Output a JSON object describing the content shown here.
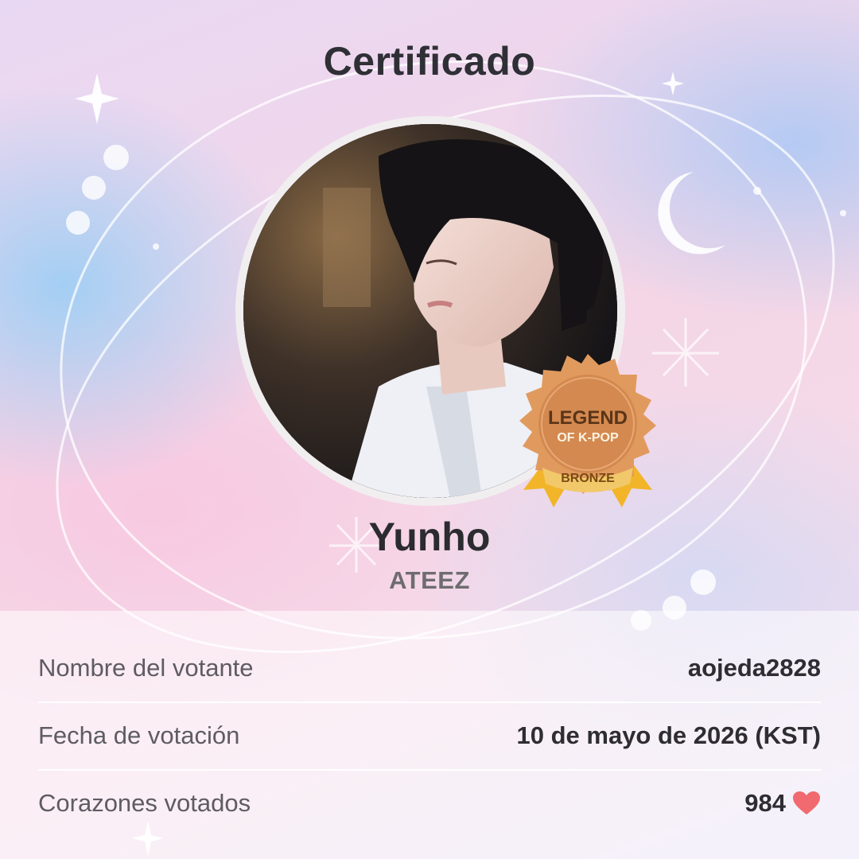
{
  "header": {
    "title": "Certificado"
  },
  "idol": {
    "name": "Yunho",
    "group": "ATEEZ",
    "photo_icon": "idol-portrait-photo"
  },
  "badge": {
    "line1": "LEGEND",
    "line2": "OF K-POP",
    "tier": "BRONZE",
    "icon": "medal-icon",
    "colors": {
      "medal": "#d3894f",
      "ribbon": "#f2b52a"
    }
  },
  "details": [
    {
      "label": "Nombre del votante",
      "value": "aojeda2828"
    },
    {
      "label": "Fecha de votación",
      "value": "10 de mayo de 2026 (KST)"
    },
    {
      "label": "Corazones votados",
      "value": "984"
    }
  ],
  "colors": {
    "heart": "#f06a6f",
    "text": "#2e2d32",
    "muted": "#5e5c62"
  }
}
